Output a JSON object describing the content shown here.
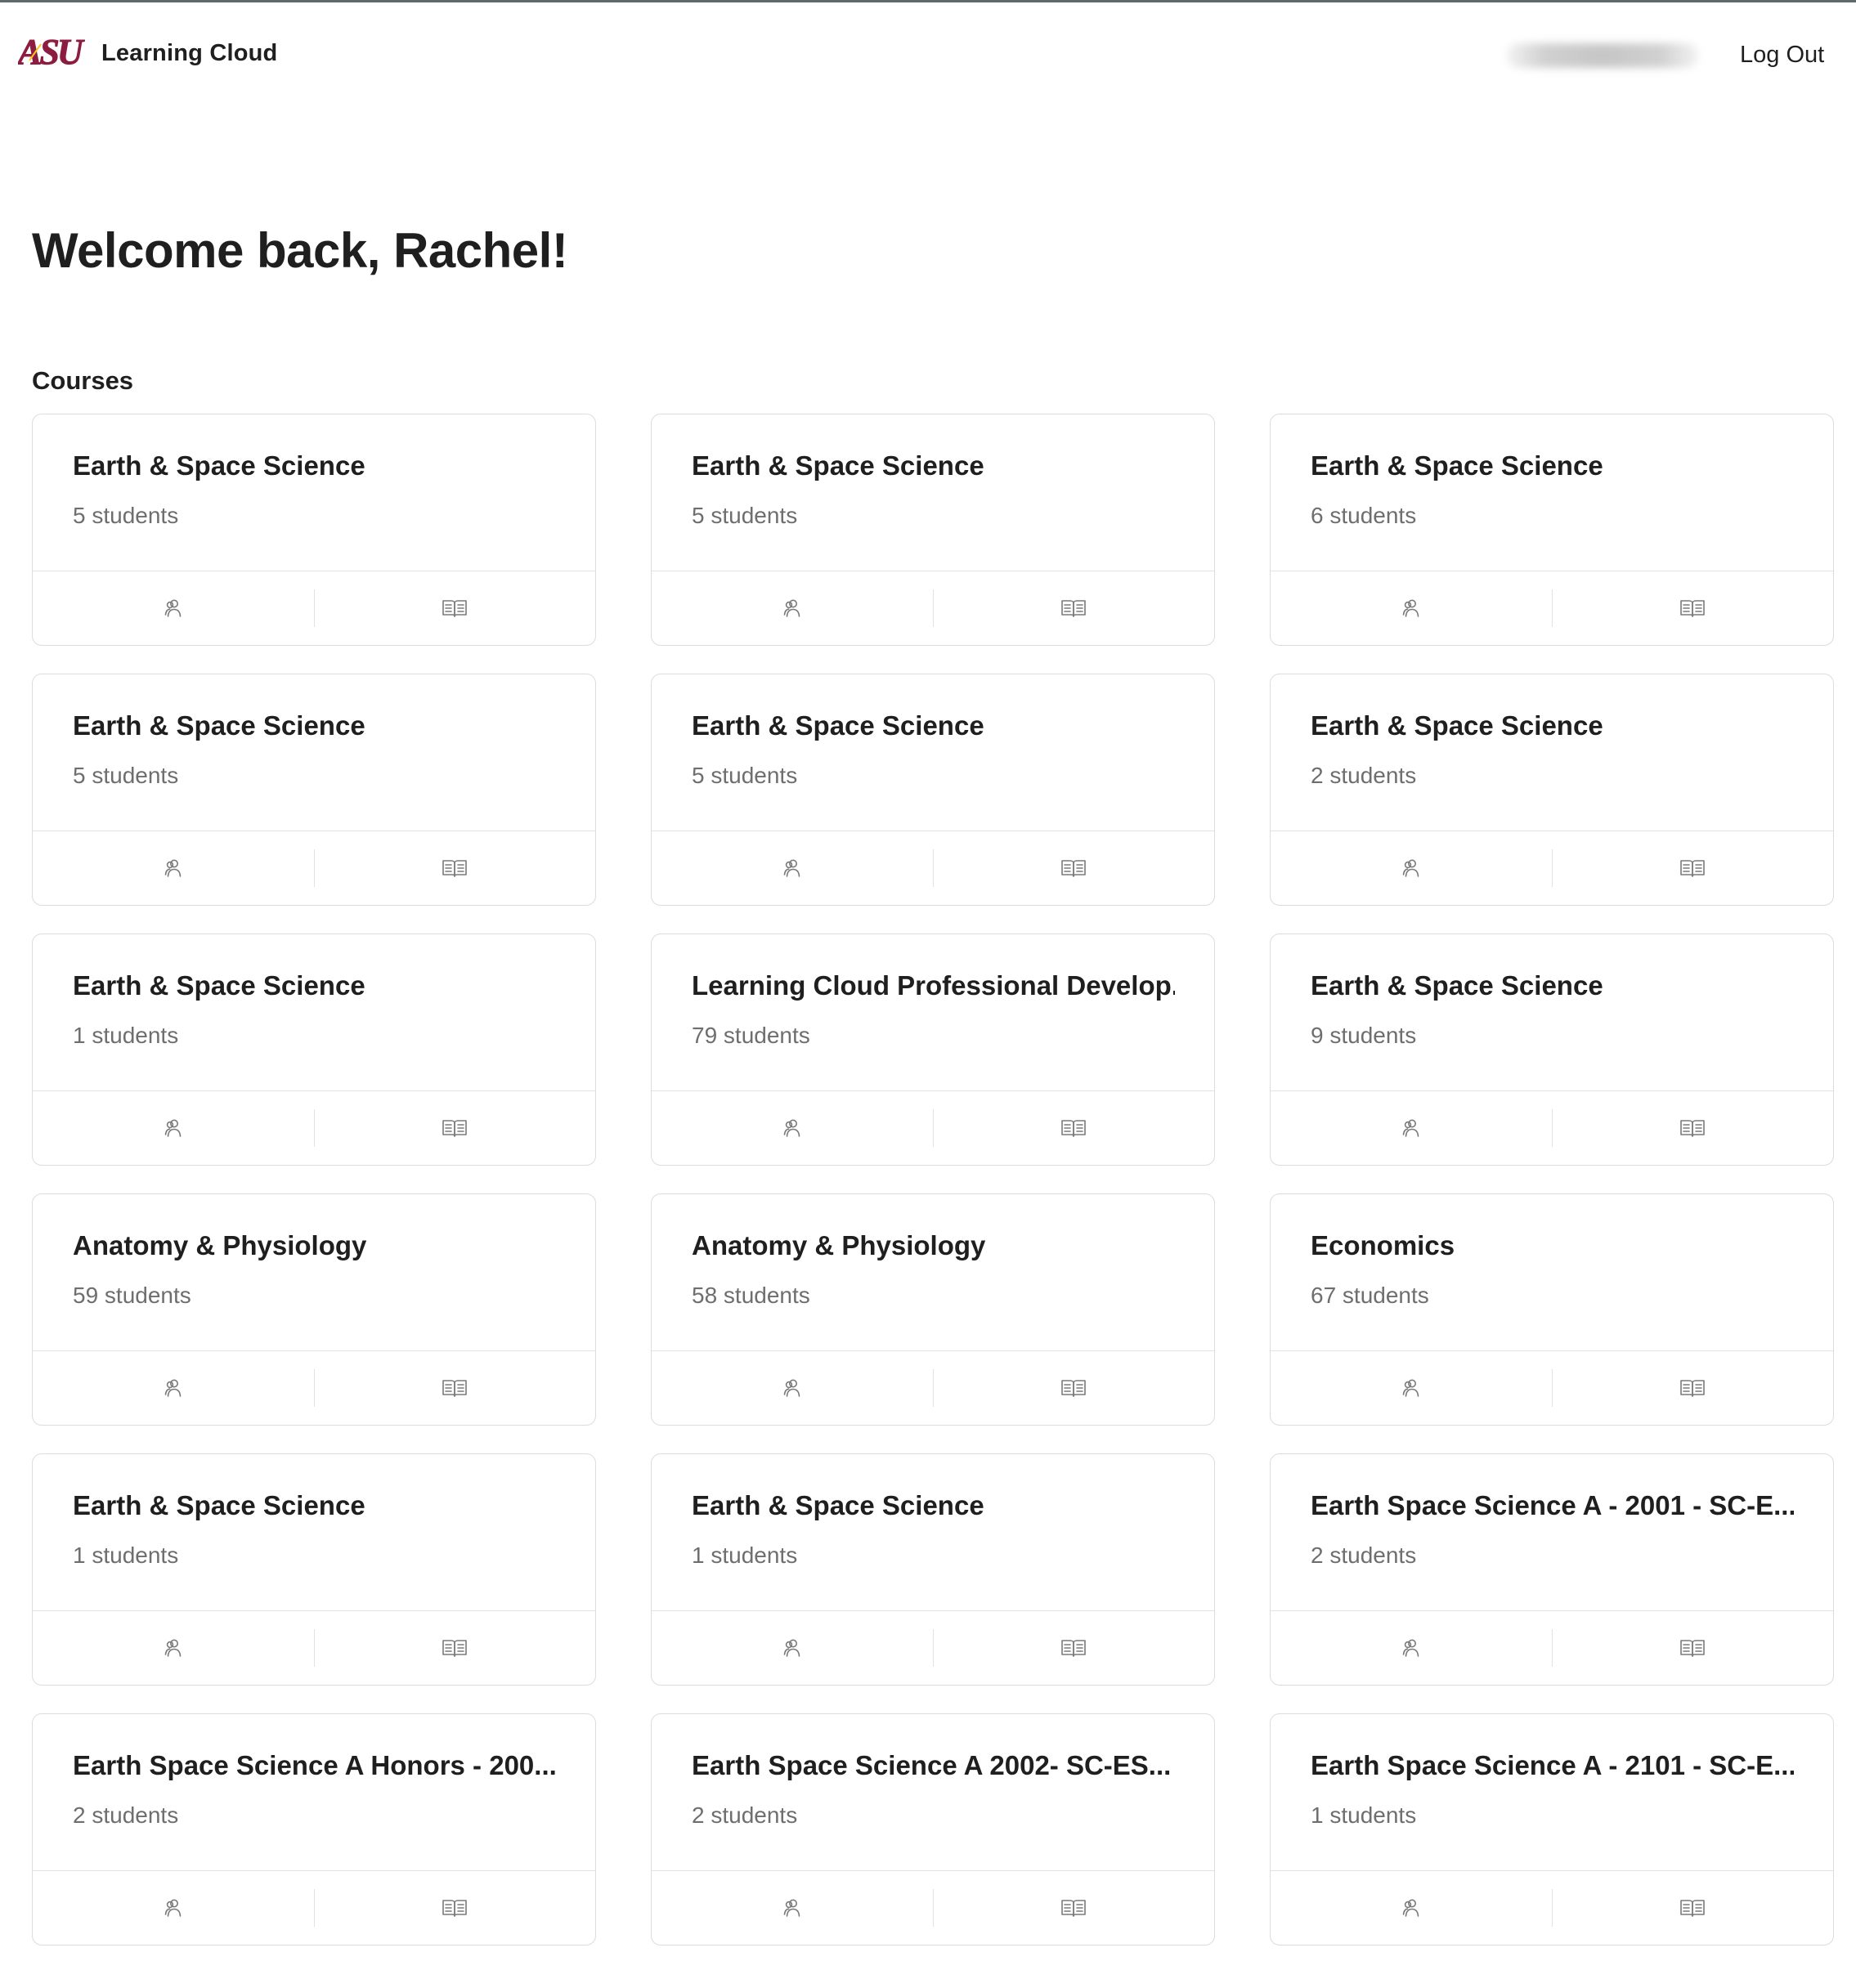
{
  "header": {
    "logo_text": "ASU",
    "app_name": "Learning Cloud",
    "logout_label": "Log Out"
  },
  "welcome": "Welcome back, Rachel!",
  "courses_heading": "Courses",
  "courses": [
    {
      "title": "Earth & Space Science",
      "students": "5 students"
    },
    {
      "title": "Earth & Space Science",
      "students": "5 students"
    },
    {
      "title": "Earth & Space Science",
      "students": "6 students"
    },
    {
      "title": "Earth & Space Science",
      "students": "5 students"
    },
    {
      "title": "Earth & Space Science",
      "students": "5 students"
    },
    {
      "title": "Earth & Space Science",
      "students": "2 students"
    },
    {
      "title": "Earth & Space Science",
      "students": "1 students"
    },
    {
      "title": "Learning Cloud Professional Develop...",
      "students": "79 students"
    },
    {
      "title": "Earth & Space Science",
      "students": "9 students"
    },
    {
      "title": "Anatomy & Physiology",
      "students": "59 students"
    },
    {
      "title": "Anatomy & Physiology",
      "students": "58 students"
    },
    {
      "title": "Economics",
      "students": "67 students"
    },
    {
      "title": "Earth & Space Science",
      "students": "1 students"
    },
    {
      "title": "Earth & Space Science",
      "students": "1 students"
    },
    {
      "title": "Earth Space Science A - 2001 - SC-E...",
      "students": "2 students"
    },
    {
      "title": "Earth Space Science A Honors - 200...",
      "students": "2 students"
    },
    {
      "title": "Earth Space Science A 2002- SC-ES...",
      "students": "2 students"
    },
    {
      "title": "Earth Space Science A - 2101 - SC-E...",
      "students": "1 students"
    }
  ],
  "card_actions": {
    "students_icon": "users-icon",
    "content_icon": "book-open-icon"
  },
  "colors": {
    "brand_maroon": "#8C1D40",
    "brand_gold": "#FFC627"
  }
}
